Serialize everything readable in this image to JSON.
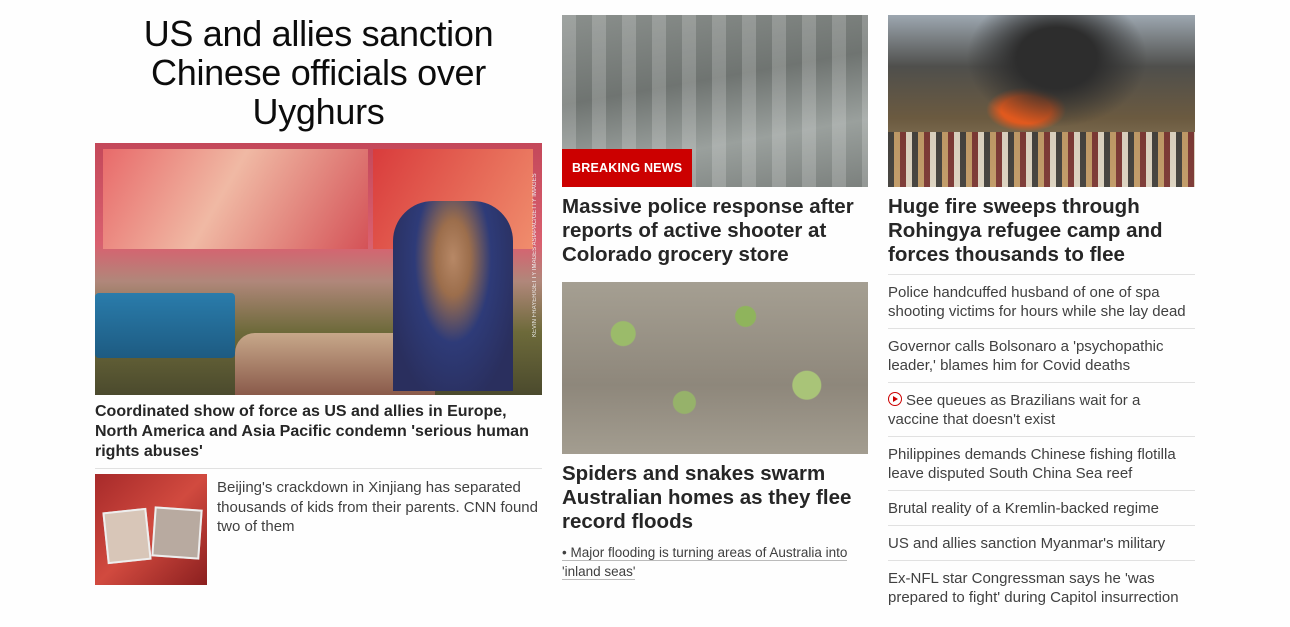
{
  "hero": {
    "title": "US and allies sanction Chinese officials over Uyghurs",
    "image_credit": "KEVIN FRAYER/GETTY IMAGES ASIAPAC/GETTY IMAGES",
    "caption": "Coordinated show of force as US and allies in Europe, North America and Asia Pacific condemn 'serious human rights abuses'",
    "sub_story": "Beijing's crackdown in Xinjiang has separated thousands of kids from their parents. CNN found two of them"
  },
  "middle": {
    "story1": {
      "badge": "BREAKING NEWS",
      "headline": "Massive police response after reports of active shooter at Colorado grocery store"
    },
    "story2": {
      "headline": "Spiders and snakes swarm Australian homes as they flee record floods",
      "related": "• Major flooding is turning areas of Australia into 'inland seas'"
    }
  },
  "right": {
    "headline": "Huge fire sweeps through Rohingya refugee camp and forces thousands to flee",
    "list": [
      "Police handcuffed husband of one of spa shooting victims for hours while she lay dead",
      "Governor calls Bolsonaro a 'psychopathic leader,' blames him for Covid deaths",
      "See queues as Brazilians wait for a vaccine that doesn't exist",
      "Philippines demands Chinese fishing flotilla leave disputed South China Sea reef",
      "Brutal reality of a Kremlin-backed regime",
      "US and allies sanction Myanmar's military",
      "Ex-NFL star Congressman says he 'was prepared to fight' during Capitol insurrection"
    ]
  },
  "colors": {
    "accent": "#cc0000",
    "text": "#262626",
    "divider": "#e1e1e1"
  },
  "icons": {
    "video": "play-icon"
  }
}
